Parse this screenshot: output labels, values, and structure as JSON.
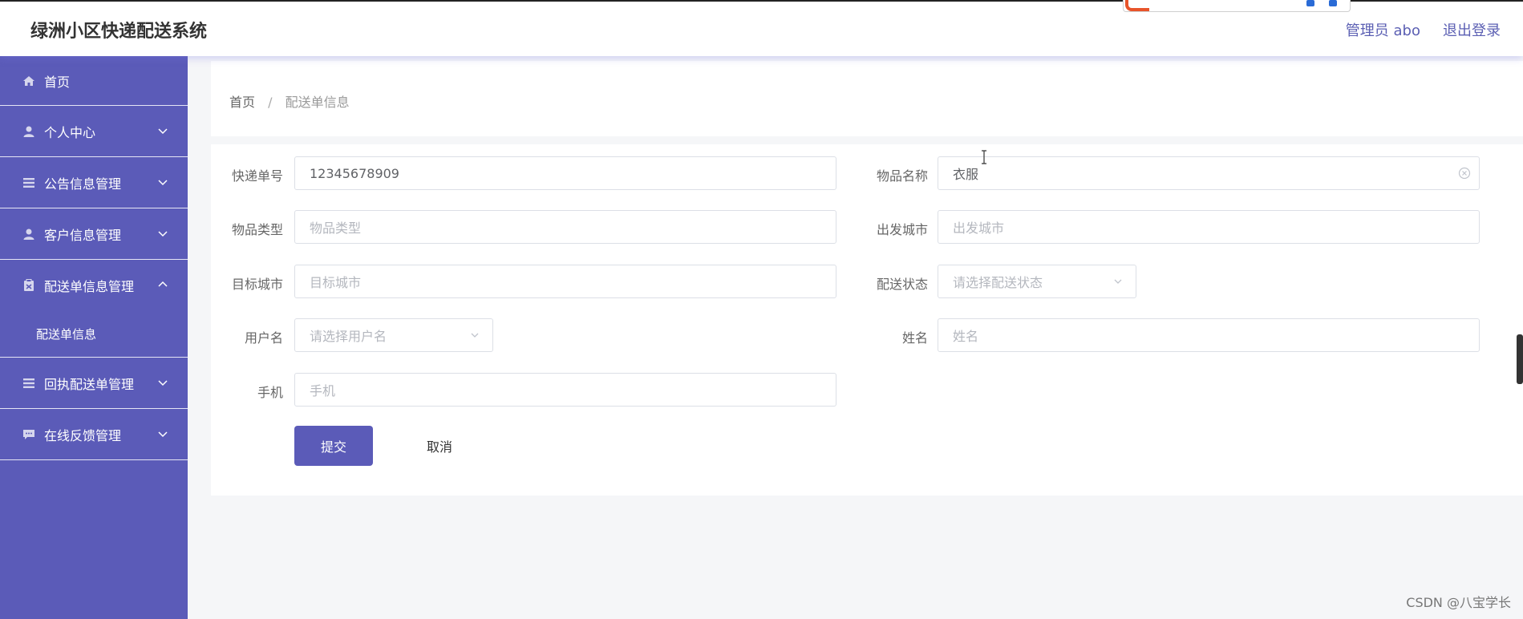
{
  "app": {
    "title": "绿洲小区快递配送系统"
  },
  "header": {
    "user_label": "管理员 abo",
    "logout_label": "退出登录"
  },
  "sidebar": {
    "items": [
      {
        "label": "首页",
        "icon": "home-icon"
      },
      {
        "label": "个人中心",
        "icon": "user-icon"
      },
      {
        "label": "公告信息管理",
        "icon": "list-icon"
      },
      {
        "label": "客户信息管理",
        "icon": "user-icon"
      },
      {
        "label": "配送单信息管理",
        "icon": "clipboard-icon",
        "expanded": true,
        "children": [
          "配送单信息"
        ]
      },
      {
        "label": "回执配送单管理",
        "icon": "list-icon"
      },
      {
        "label": "在线反馈管理",
        "icon": "chat-icon"
      }
    ],
    "background": "#5b5bb8"
  },
  "breadcrumb": {
    "home": "首页",
    "separator": "/",
    "current": "配送单信息"
  },
  "form": {
    "fields": {
      "tracking_no": {
        "label": "快递单号",
        "value": "12345678909"
      },
      "item_name": {
        "label": "物品名称",
        "value": "衣服"
      },
      "item_type": {
        "label": "物品类型",
        "placeholder": "物品类型"
      },
      "departure_city": {
        "label": "出发城市",
        "placeholder": "出发城市"
      },
      "target_city": {
        "label": "目标城市",
        "placeholder": "目标城市"
      },
      "status": {
        "label": "配送状态",
        "placeholder": "请选择配送状态"
      },
      "username": {
        "label": "用户名",
        "placeholder": "请选择用户名"
      },
      "name": {
        "label": "姓名",
        "placeholder": "姓名"
      },
      "phone": {
        "label": "手机",
        "placeholder": "手机"
      }
    },
    "submit_label": "提交",
    "cancel_label": "取消"
  },
  "watermark": "CSDN @八宝学长",
  "colors": {
    "accent": "#5b5bb8",
    "link": "#5b5fb3"
  }
}
